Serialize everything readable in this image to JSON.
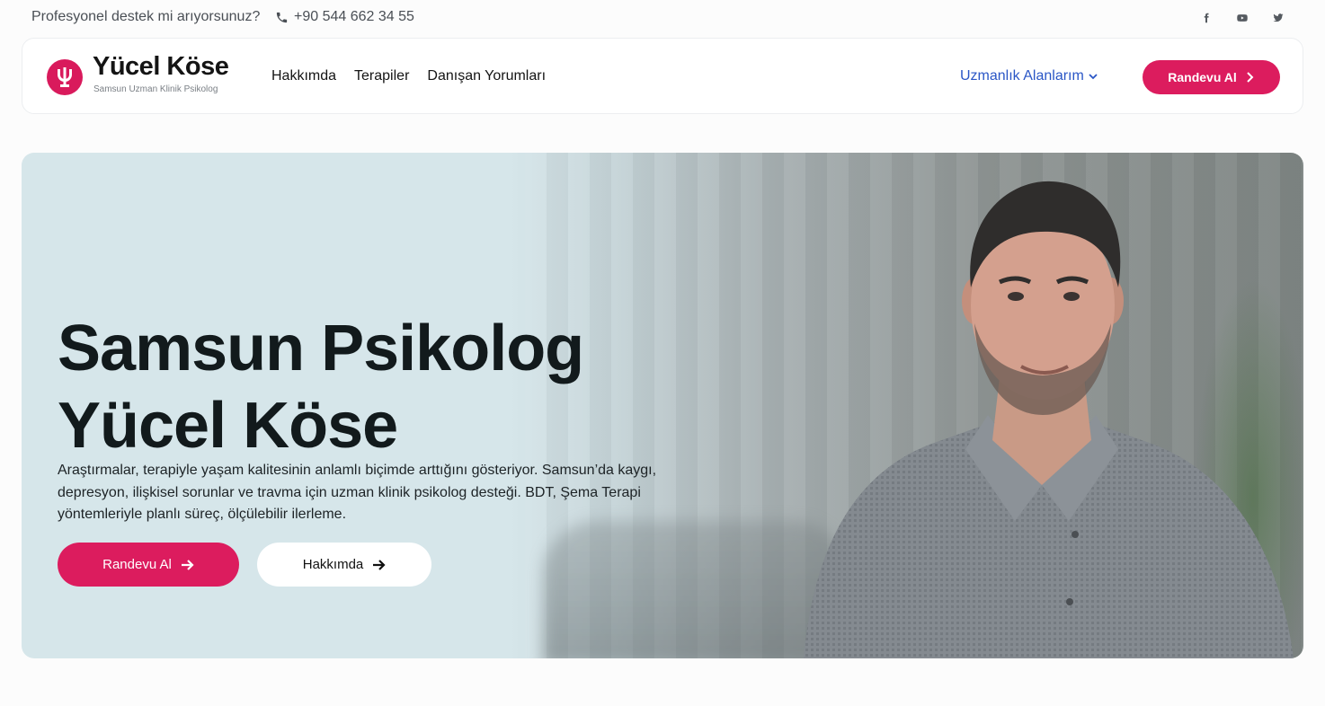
{
  "topbar": {
    "message": "Profesyonel destek mi arıyorsunuz?",
    "phone": "+90 544 662 34 55",
    "social_icons": [
      "facebook-icon",
      "youtube-icon",
      "twitter-icon"
    ]
  },
  "header": {
    "brand": "Yücel Köse",
    "subtitle": "Samsun Uzman Klinik Psikolog",
    "nav": [
      "Hakkımda",
      "Terapiler",
      "Danışan Yorumları"
    ],
    "specialty_menu": "Uzmanlık Alanlarım",
    "cta": "Randevu Al"
  },
  "hero": {
    "title_line1": "Samsun Psikolog",
    "title_line2": "Yücel Köse",
    "description": "Araştırmalar, terapiyle yaşam kalitesinin anlamlı biçimde arttığını gösteriyor.  Samsun’da kaygı, depresyon, ilişkisel sorunlar ve travma için uzman klinik psikolog desteği. BDT, Şema Terapi yöntemleriyle planlı süreç, ölçülebilir ilerleme.",
    "primary_button": "Randevu Al",
    "secondary_button": "Hakkımda"
  },
  "colors": {
    "accent": "#dc1c5e",
    "link_blue": "#2a56c6",
    "hero_bg": "#d6e6ea"
  }
}
